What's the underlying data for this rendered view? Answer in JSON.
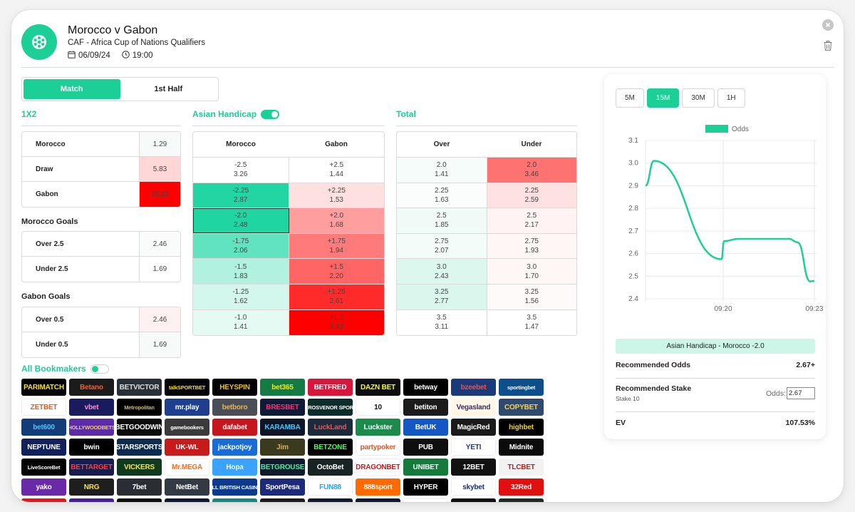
{
  "header": {
    "title": "Morocco v Gabon",
    "competition": "CAF - Africa Cup of Nations Qualifiers",
    "date": "06/09/24",
    "time": "19:00"
  },
  "tabs": [
    {
      "label": "Match",
      "active": true
    },
    {
      "label": "1st Half",
      "active": false
    }
  ],
  "sections": {
    "one_x_two": {
      "title": "1X2",
      "rows": [
        {
          "label": "Morocco",
          "odds": "1.29",
          "color": "#f6fbfa"
        },
        {
          "label": "Draw",
          "odds": "5.83",
          "color": "#ffd7d7"
        },
        {
          "label": "Gabon",
          "odds": "19.18",
          "color": "#ff0000"
        }
      ]
    },
    "morocco_goals": {
      "title": "Morocco Goals",
      "rows": [
        {
          "label": "Over 2.5",
          "odds": "2.46",
          "color": "#fafcfb"
        },
        {
          "label": "Under 2.5",
          "odds": "1.69",
          "color": "#ffffff"
        }
      ]
    },
    "gabon_goals": {
      "title": "Gabon Goals",
      "rows": [
        {
          "label": "Over 0.5",
          "odds": "2.46",
          "color": "#fff1f1"
        },
        {
          "label": "Under 0.5",
          "odds": "1.69",
          "color": "#f6fbfa"
        }
      ]
    },
    "asian_handicap": {
      "title": "Asian Handicap",
      "toggle_on": true,
      "columns": [
        "Morocco",
        "Gabon"
      ],
      "rows": [
        {
          "home": {
            "line": "-2.5",
            "odds": "3.26",
            "color": "#ffffff"
          },
          "away": {
            "line": "+2.5",
            "odds": "1.44",
            "color": "#ffffff"
          }
        },
        {
          "home": {
            "line": "-2.25",
            "odds": "2.87",
            "color": "#22d6a4"
          },
          "away": {
            "line": "+2.25",
            "odds": "1.53",
            "color": "#ffe0e0"
          }
        },
        {
          "home": {
            "line": "-2.0",
            "odds": "2.48",
            "color": "#1fd5a2",
            "selected": true
          },
          "away": {
            "line": "+2.0",
            "odds": "1.68",
            "color": "#ff9e9e"
          }
        },
        {
          "home": {
            "line": "-1.75",
            "odds": "2.06",
            "color": "#62e3c0"
          },
          "away": {
            "line": "+1.75",
            "odds": "1.94",
            "color": "#ff7a7a"
          }
        },
        {
          "home": {
            "line": "-1.5",
            "odds": "1.83",
            "color": "#b0f1df"
          },
          "away": {
            "line": "+1.5",
            "odds": "2.20",
            "color": "#ff6565"
          }
        },
        {
          "home": {
            "line": "-1.25",
            "odds": "1.62",
            "color": "#d3f7ed"
          },
          "away": {
            "line": "+1.25",
            "odds": "2.61",
            "color": "#ff2a2a"
          }
        },
        {
          "home": {
            "line": "-1.0",
            "odds": "1.41",
            "color": "#e6faf4"
          },
          "away": {
            "line": "+1.0",
            "odds": "3.43",
            "color": "#ff0000"
          }
        }
      ]
    },
    "total": {
      "title": "Total",
      "columns": [
        "Over",
        "Under"
      ],
      "rows": [
        {
          "over": {
            "line": "2.0",
            "odds": "1.41",
            "color": "#f6fcfa"
          },
          "under": {
            "line": "2.0",
            "odds": "3.46",
            "color": "#ff7272"
          }
        },
        {
          "over": {
            "line": "2.25",
            "odds": "1.63",
            "color": "#fafdfc"
          },
          "under": {
            "line": "2.25",
            "odds": "2.59",
            "color": "#ffe1e1"
          }
        },
        {
          "over": {
            "line": "2.5",
            "odds": "1.85",
            "color": "#f0fbf7"
          },
          "under": {
            "line": "2.5",
            "odds": "2.17",
            "color": "#fff3f3"
          }
        },
        {
          "over": {
            "line": "2.75",
            "odds": "2.07",
            "color": "#f3fcf9"
          },
          "under": {
            "line": "2.75",
            "odds": "1.93",
            "color": "#fff6f6"
          }
        },
        {
          "over": {
            "line": "3.0",
            "odds": "2.43",
            "color": "#dcf8ee"
          },
          "under": {
            "line": "3.0",
            "odds": "1.70",
            "color": "#fff6f6"
          }
        },
        {
          "over": {
            "line": "3.25",
            "odds": "2.77",
            "color": "#d9f7ed"
          },
          "under": {
            "line": "3.25",
            "odds": "1.56",
            "color": "#fffafa"
          }
        },
        {
          "over": {
            "line": "3.5",
            "odds": "3.11",
            "color": "#ffffff"
          },
          "under": {
            "line": "3.5",
            "odds": "1.47",
            "color": "#ffffff"
          }
        }
      ]
    }
  },
  "bookmakers": {
    "title": "All Bookmakers",
    "toggle_on": false,
    "items": [
      {
        "name": "PARIMATCH",
        "bg": "#000000",
        "fg": "#f8e11b"
      },
      {
        "name": "Betano",
        "bg": "#1b1b1b",
        "fg": "#ff5a1f"
      },
      {
        "name": "BETVICTOR",
        "bg": "#2b2f36",
        "fg": "#d8dde5"
      },
      {
        "name": "talkSPORTBET",
        "bg": "#000000",
        "fg": "#ffde00"
      },
      {
        "name": "HEYSPIN",
        "bg": "#000000",
        "fg": "#f2c200"
      },
      {
        "name": "bet365",
        "bg": "#147b45",
        "fg": "#ffe600"
      },
      {
        "name": "BETFRED",
        "bg": "#d6173b",
        "fg": "#ffffff"
      },
      {
        "name": "DAZN BET",
        "bg": "#0c0c0c",
        "fg": "#f6ff00"
      },
      {
        "name": "betway",
        "bg": "#000000",
        "fg": "#ffffff"
      },
      {
        "name": "bzeebet",
        "bg": "#1a3a7a",
        "fg": "#ff4c3b"
      },
      {
        "name": "sportingbet",
        "bg": "#0d4f8c",
        "fg": "#ffffff"
      },
      {
        "name": "ZETBET",
        "bg": "#ffffff",
        "fg": "#e05a1a"
      },
      {
        "name": "vbet",
        "bg": "#1a1a5e",
        "fg": "#ff8ad8"
      },
      {
        "name": "Metropolitan",
        "bg": "#000000",
        "fg": "#d6b26a"
      },
      {
        "name": "mr.play",
        "bg": "#1e3f8f",
        "fg": "#ffffff"
      },
      {
        "name": "betboro",
        "bg": "#4a4f57",
        "fg": "#e9b44c"
      },
      {
        "name": "BRESBET",
        "bg": "#101935",
        "fg": "#ff2e72"
      },
      {
        "name": "GROSVENOR SPORT",
        "bg": "#0e2c2a",
        "fg": "#ffffff"
      },
      {
        "name": "10",
        "bg": "#ffffff",
        "fg": "#111111"
      },
      {
        "name": "betiton",
        "bg": "#1b1b1b",
        "fg": "#ffffff"
      },
      {
        "name": "Vegasland",
        "bg": "#fff6e6",
        "fg": "#3a2b6b"
      },
      {
        "name": "COPYBET",
        "bg": "#2f4a6e",
        "fg": "#f7d34a"
      },
      {
        "name": "bet600",
        "bg": "#133d78",
        "fg": "#4fc3ff"
      },
      {
        "name": "HOLLYWOODBETS",
        "bg": "#5b2ba8",
        "fg": "#f8d33a"
      },
      {
        "name": "BETGOODWIN",
        "bg": "#0b0b0b",
        "fg": "#ffffff"
      },
      {
        "name": "gamebookers",
        "bg": "#3a3a3a",
        "fg": "#ffffff"
      },
      {
        "name": "dafabet",
        "bg": "#c4161c",
        "fg": "#ffffff"
      },
      {
        "name": "KARAMBA",
        "bg": "#0f1528",
        "fg": "#3cc9ff"
      },
      {
        "name": "LuckLand",
        "bg": "#1d2a3c",
        "fg": "#ff4d4d"
      },
      {
        "name": "Luckster",
        "bg": "#1b8a4b",
        "fg": "#ffffff"
      },
      {
        "name": "BetUK",
        "bg": "#1456c4",
        "fg": "#ffffff"
      },
      {
        "name": "MagicRed",
        "bg": "#1a1a1a",
        "fg": "#ffffff"
      },
      {
        "name": "highbet",
        "bg": "#000000",
        "fg": "#ffd200"
      },
      {
        "name": "NEPTUNE",
        "bg": "#12215a",
        "fg": "#ffffff"
      },
      {
        "name": "bwin",
        "bg": "#000000",
        "fg": "#ffffff"
      },
      {
        "name": "STARSPORTS",
        "bg": "#0d2b4f",
        "fg": "#ffffff"
      },
      {
        "name": "UK-WL",
        "bg": "#c71a1a",
        "fg": "#ffffff"
      },
      {
        "name": "jackpotjoy",
        "bg": "#1b6bd6",
        "fg": "#ffffff"
      },
      {
        "name": "Jim",
        "bg": "#3b3a1f",
        "fg": "#d9b25a"
      },
      {
        "name": "BETZONE",
        "bg": "#000000",
        "fg": "#3cff5a"
      },
      {
        "name": "partypoker",
        "bg": "#ffffff",
        "fg": "#e0531f"
      },
      {
        "name": "PUB",
        "bg": "#0e0e0e",
        "fg": "#ffffff"
      },
      {
        "name": "YETI",
        "bg": "#ffffff",
        "fg": "#1d3c8f"
      },
      {
        "name": "Midnite",
        "bg": "#0b0b0b",
        "fg": "#ffffff"
      },
      {
        "name": "LiveScoreBet",
        "bg": "#000000",
        "fg": "#ffffff"
      },
      {
        "name": "BETTARGET",
        "bg": "#151d4f",
        "fg": "#ff3b3b"
      },
      {
        "name": "VICKERS",
        "bg": "#0f3a1d",
        "fg": "#f5e342"
      },
      {
        "name": "Mr.MEGA",
        "bg": "#ffffff",
        "fg": "#ff6b1a"
      },
      {
        "name": "Hopa",
        "bg": "#3aa3ff",
        "fg": "#ffffff"
      },
      {
        "name": "BETGROUSE",
        "bg": "#0f1a2a",
        "fg": "#3cf0a3"
      },
      {
        "name": "OctoBet",
        "bg": "#1a2323",
        "fg": "#ffffff"
      },
      {
        "name": "DRAGONBET",
        "bg": "#ffffff",
        "fg": "#d0161b"
      },
      {
        "name": "UNIBET",
        "bg": "#147b3a",
        "fg": "#ffffff"
      },
      {
        "name": "12BET",
        "bg": "#111111",
        "fg": "#ffffff"
      },
      {
        "name": "TLCBET",
        "bg": "#f2f2f2",
        "fg": "#c81a1a"
      },
      {
        "name": "yako",
        "bg": "#6a2aa8",
        "fg": "#ffffff"
      },
      {
        "name": "NRG",
        "bg": "#1e1e1e",
        "fg": "#f5e342"
      },
      {
        "name": "7bet",
        "bg": "#2a2e34",
        "fg": "#ffffff"
      },
      {
        "name": "NetBet",
        "bg": "#343a44",
        "fg": "#ffffff"
      },
      {
        "name": "ALL BRITISH CASINO",
        "bg": "#0d3a8f",
        "fg": "#ffffff"
      },
      {
        "name": "SportPesa",
        "bg": "#1d2a7a",
        "fg": "#ffffff"
      },
      {
        "name": "FUN88",
        "bg": "#ffffff",
        "fg": "#1aa3ff"
      },
      {
        "name": "888sport",
        "bg": "#ff6a00",
        "fg": "#ffffff"
      },
      {
        "name": "HYPER",
        "bg": "#000000",
        "fg": "#ffffff"
      },
      {
        "name": "skybet",
        "bg": "#ffffff",
        "fg": "#0e2c8a"
      },
      {
        "name": "32Red",
        "bg": "#e01010",
        "fg": "#ffffff"
      },
      {
        "name": "",
        "bg": "#e8141c",
        "fg": "#ffffff"
      },
      {
        "name": "",
        "bg": "#4a1ba0",
        "fg": "#ffffff"
      },
      {
        "name": "",
        "bg": "#0a0a0a",
        "fg": "#ffffff"
      },
      {
        "name": "",
        "bg": "#0e1836",
        "fg": "#ffffff"
      },
      {
        "name": "",
        "bg": "#128a84",
        "fg": "#ffffff"
      },
      {
        "name": "",
        "bg": "#1b1b1b",
        "fg": "#ffffff"
      },
      {
        "name": "",
        "bg": "#0e1a34",
        "fg": "#ffffff"
      },
      {
        "name": "",
        "bg": "#0e1834",
        "fg": "#ffffff"
      },
      {
        "name": "",
        "bg": "#ffffff",
        "fg": "#e04ca0"
      },
      {
        "name": "",
        "bg": "#0d0d0d",
        "fg": "#ffffff"
      },
      {
        "name": "",
        "bg": "#1e2a22",
        "fg": "#ffffff"
      }
    ]
  },
  "side_panel": {
    "intervals": [
      {
        "label": "5M",
        "active": false
      },
      {
        "label": "15M",
        "active": true
      },
      {
        "label": "30M",
        "active": false
      },
      {
        "label": "1H",
        "active": false
      }
    ],
    "pick_label": "Asian Handicap - Morocco -2.0",
    "recommended_odds_label": "Recommended Odds",
    "recommended_odds_value": "2.67+",
    "recommended_stake_label": "Recommended Stake",
    "stake_sub": "Stake 10",
    "odds_input_label": "Odds:",
    "odds_input_value": "2.67",
    "ev_label": "EV",
    "ev_value": "107.53%"
  },
  "accent_color": "#1bcf97",
  "chart_data": {
    "type": "line",
    "title": "",
    "legend": [
      "Odds"
    ],
    "legend_position": "top",
    "series": [
      {
        "name": "Odds",
        "color": "#1bcf97",
        "points": [
          {
            "t": 0.0,
            "y": 2.9
          },
          {
            "t": 0.05,
            "y": 3.01
          },
          {
            "t": 0.45,
            "y": 2.575
          },
          {
            "t": 0.465,
            "y": 2.655
          },
          {
            "t": 0.55,
            "y": 2.665
          },
          {
            "t": 0.85,
            "y": 2.665
          },
          {
            "t": 0.9,
            "y": 2.65
          },
          {
            "t": 0.975,
            "y": 2.477
          },
          {
            "t": 1.0,
            "y": 2.479
          }
        ]
      }
    ],
    "x_tick_labels": [
      {
        "t": 0.46,
        "label": "09:20"
      },
      {
        "t": 1.0,
        "label": "09:23"
      }
    ],
    "y_ticks": [
      2.4,
      2.5,
      2.6,
      2.7,
      2.8,
      2.9,
      3.0,
      3.1
    ],
    "ylim": [
      2.4,
      3.1
    ],
    "grid": true,
    "xlabel": "",
    "ylabel": ""
  }
}
